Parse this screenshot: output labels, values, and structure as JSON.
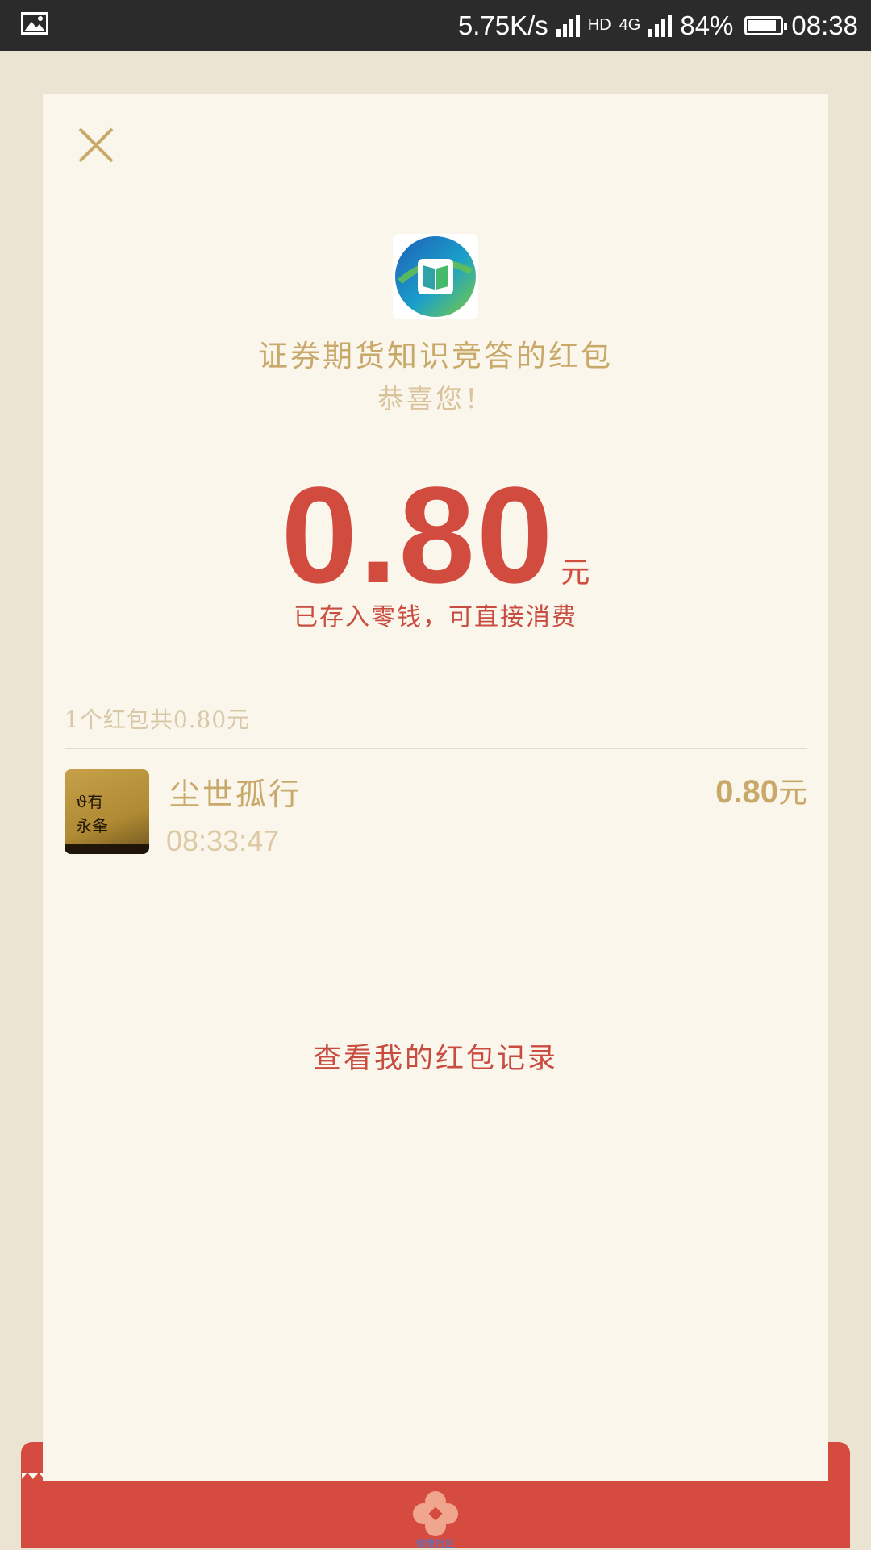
{
  "status_bar": {
    "speed": "5.75K/s",
    "network": "4G",
    "hd": "HD",
    "battery": "84%",
    "time": "08:38"
  },
  "card": {
    "title": "证券期货知识竞答的红包",
    "subtitle": "恭喜您！",
    "amount": "0.80",
    "amount_unit": "元",
    "saved_note": "已存入零钱，可直接消费",
    "summary": "1个红包共0.80元",
    "record_link": "查看我的红包记录"
  },
  "list": [
    {
      "name": "尘世孤行",
      "time": "08:33:47",
      "amount": "0.80",
      "unit": "元"
    }
  ],
  "footer": {
    "label": "微聚社区"
  },
  "colors": {
    "accent_red": "#d24b3f",
    "gold": "#c9a96a",
    "card_bg": "#faf6ec",
    "page_bg": "#ece4d3"
  },
  "icons": [
    "image-icon",
    "close-icon",
    "app-logo-icon",
    "flower-icon"
  ]
}
